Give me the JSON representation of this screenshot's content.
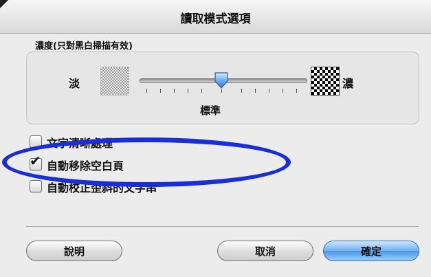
{
  "dialog": {
    "title": "讀取模式選項"
  },
  "density": {
    "group_label": "濃度(只對黑白掃描有效)",
    "light_label": "淡",
    "dark_label": "濃",
    "level_label": "標準",
    "slider_value_fraction": 0.5
  },
  "options": [
    {
      "label": "文字清晰處理",
      "checked": false
    },
    {
      "label": "自動移除空白頁",
      "checked": true
    },
    {
      "label": "自動校正歪斜的文字串",
      "checked": false
    }
  ],
  "buttons": {
    "help": "說明",
    "cancel": "取消",
    "ok": "確定"
  },
  "colors": {
    "annotation": "#1a2ed8",
    "default_button": "#4a95e3"
  },
  "icons": {
    "check": "✔"
  }
}
